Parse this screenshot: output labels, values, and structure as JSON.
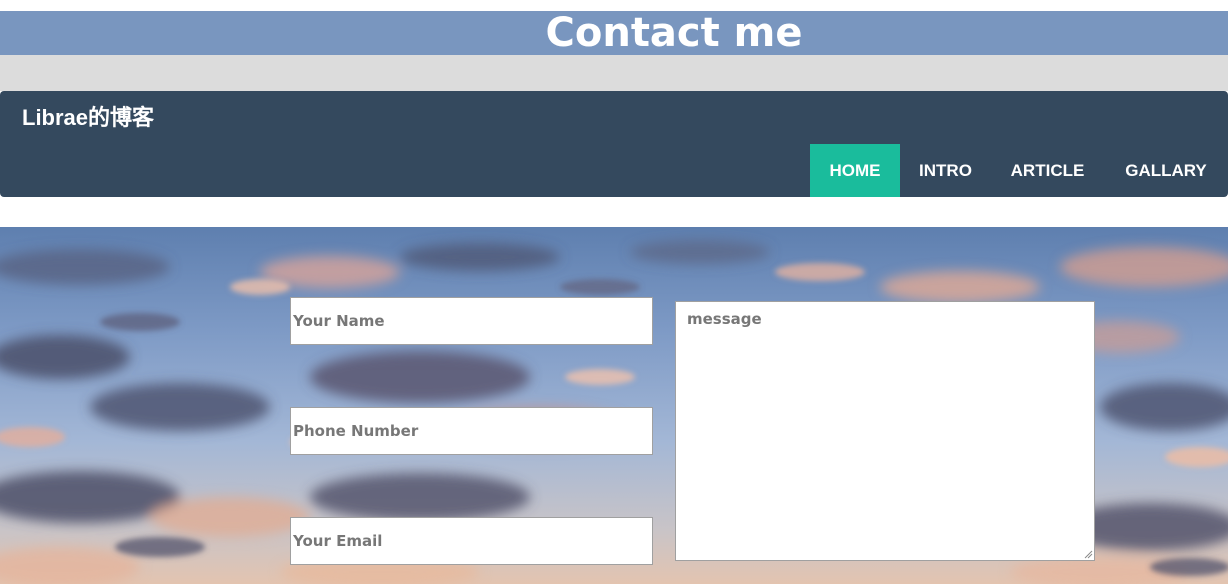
{
  "header": {
    "title": "Contact me"
  },
  "navbar": {
    "brand": "Librae的博客",
    "items": [
      {
        "label": "HOME",
        "active": true
      },
      {
        "label": "INTRO",
        "active": false
      },
      {
        "label": "ARTICLE",
        "active": false
      },
      {
        "label": "GALLARY",
        "active": false
      }
    ]
  },
  "form": {
    "name_placeholder": "Your Name",
    "phone_placeholder": "Phone Number",
    "email_placeholder": "Your Email",
    "message_placeholder": "message"
  },
  "colors": {
    "title_bar": "#7996bf",
    "navbar": "#34495e",
    "nav_active": "#1abc9c",
    "strip": "#dcdcdc"
  },
  "icons": {
    "resize": "resize-grip-icon"
  }
}
